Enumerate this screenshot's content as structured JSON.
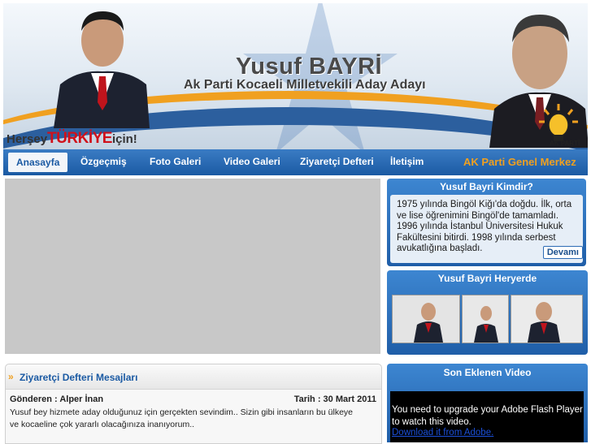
{
  "header": {
    "name": "Yusuf BAYRİ",
    "subtitle": "Ak Parti Kocaeli Milletvekili Aday Adayı",
    "slogan_prefix": "Herşey",
    "slogan_brand": "TÜRKİYE",
    "slogan_suffix": "için!",
    "logo_label": "AK PARTİ"
  },
  "nav": {
    "items": [
      {
        "label": "Anasayfa",
        "active": true
      },
      {
        "label": "Özgeçmiş"
      },
      {
        "label": "Foto Galeri"
      },
      {
        "label": "Video Galeri"
      },
      {
        "label": "Ziyaretçi Defteri"
      },
      {
        "label": "İletişim"
      }
    ],
    "akp_link": "AK Parti Genel Merkez"
  },
  "bio_panel": {
    "title": "Yusuf Bayri Kimdir?",
    "text": "1975 yılında Bingöl Kiğı'da doğdu. İlk, orta ve lise öğrenimini Bingöl'de tamamladı. 1996 yılında İstanbul Üniversitesi Hukuk Fakültesini bitirdi. 1998 yılında serbest avukatlığına başladı.",
    "more_label": "Devamı"
  },
  "gallery_panel": {
    "title": "Yusuf Bayri Heryerde"
  },
  "messages": {
    "title": "Ziyaretçi Defteri Mesajları",
    "sender": "Gönderen : Alper İnan",
    "date": "Tarih : 30 Mart 2011",
    "text": "Yusuf bey hizmete aday olduğunuz için gerçekten sevindim.. Sizin gibi insanların bu ülkeye ve kocaeline çok yararlı olacağınıza inanıyorum.."
  },
  "video_panel": {
    "title": "Son Eklenen Video",
    "flash_message": "You need to upgrade your Adobe Flash Player to watch this video.",
    "flash_link": "Download it from Adobe."
  },
  "colors": {
    "nav_blue": "#1b5aa3",
    "accent_orange": "#f0a020",
    "brand_red": "#d0101a"
  }
}
